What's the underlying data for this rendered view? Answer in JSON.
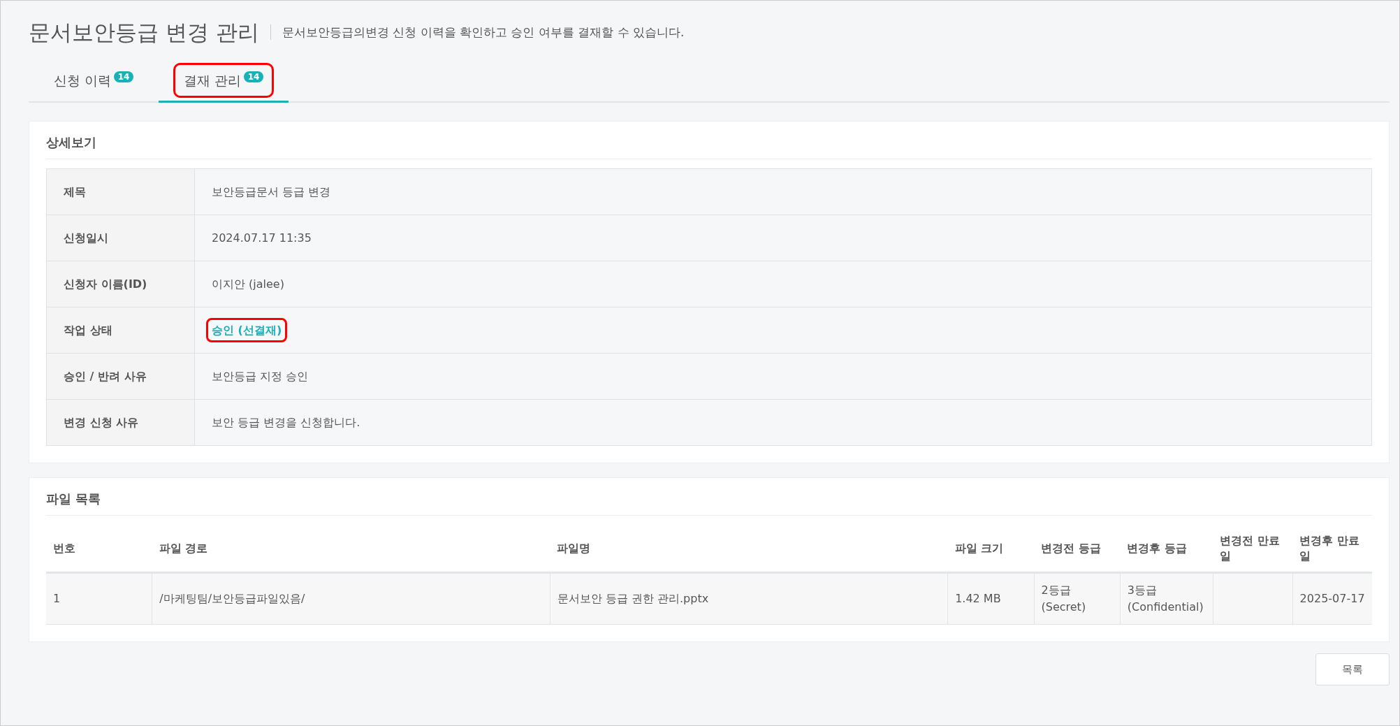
{
  "page": {
    "title": "문서보안등급 변경 관리",
    "description": "문서보안등급의변경 신청 이력을 확인하고 승인 여부를 결재할 수 있습니다."
  },
  "tabs": [
    {
      "label": "신청 이력",
      "badge": "14",
      "selected": false,
      "highlighted": false
    },
    {
      "label": "결재 관리",
      "badge": "14",
      "selected": true,
      "highlighted": true
    }
  ],
  "detail": {
    "heading": "상세보기",
    "rows": [
      {
        "label": "제목",
        "value": "보안등급문서 등급 변경",
        "kind": "text",
        "highlighted": false
      },
      {
        "label": "신청일시",
        "value": "2024.07.17 11:35",
        "kind": "text",
        "highlighted": false
      },
      {
        "label": "신청자 이름(ID)",
        "value": "이지안 (jalee)",
        "kind": "text",
        "highlighted": false
      },
      {
        "label": "작업 상태",
        "value": "승인 (선결재)",
        "kind": "status",
        "highlighted": true
      },
      {
        "label": "승인 / 반려 사유",
        "value": "보안등급 지정 승인",
        "kind": "text",
        "highlighted": false
      },
      {
        "label": "변경 신청 사유",
        "value": "보안 등급 변경을 신청합니다.",
        "kind": "text",
        "highlighted": false
      }
    ]
  },
  "files": {
    "heading": "파일 목록",
    "columns": [
      "번호",
      "파일 경로",
      "파일명",
      "파일 크기",
      "변경전 등급",
      "변경후 등급",
      "변경전 만료일",
      "변경후 만료일"
    ],
    "rows": [
      [
        "1",
        "/마케팅팀/보안등급파일있음/",
        "문서보안 등급 권한 관리.pptx",
        "1.42 MB",
        "2등급 (Secret)",
        "3등급 (Confidential)",
        "",
        "2025-07-17"
      ]
    ]
  },
  "buttons": [
    "목록"
  ]
}
